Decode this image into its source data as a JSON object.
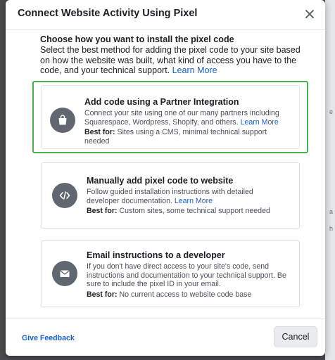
{
  "dialog": {
    "title": "Connect Website Activity Using Pixel",
    "intro_heading": "Choose how you want to install the pixel code",
    "intro_text": "Select the best method for adding the pixel code to your site based on how the website was built, what kind of access you have to the code, and your technical support.",
    "intro_link": "Learn More"
  },
  "options": [
    {
      "title": "Add code using a Partner Integration",
      "description": "Connect your site using one of our many partners including Squarespace, Wordpress, Shopify, and others.",
      "link": "Learn More",
      "best_for_label": "Best for:",
      "best_for_text": "Sites using a CMS, minimal technical support needed",
      "icon": "shopping-bag-icon",
      "selected": true
    },
    {
      "title": "Manually add pixel code to website",
      "description": "Follow guided installation instructions with detailed developer documentation.",
      "link": "Learn More",
      "best_for_label": "Best for:",
      "best_for_text": "Custom sites, some technical support needed",
      "icon": "code-icon",
      "selected": false
    },
    {
      "title": "Email instructions to a developer",
      "description": "If you don't have direct access to your site's code, send instructions and documentation to your technical support. Be sure to include the pixel ID in your email.",
      "link": "",
      "best_for_label": "Best for:",
      "best_for_text": "No current access to website code base",
      "icon": "envelope-icon",
      "selected": false
    }
  ],
  "footer": {
    "feedback_label": "Give Feedback",
    "cancel_label": "Cancel"
  },
  "colors": {
    "selection_border": "#4caf50",
    "link": "#1a5ecf",
    "icon_circle": "#606770"
  }
}
